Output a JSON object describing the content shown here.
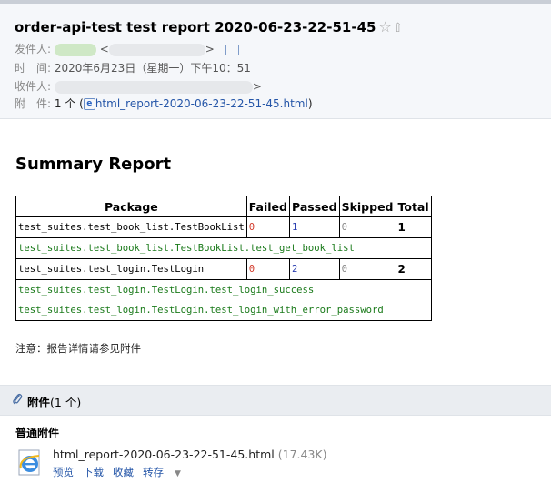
{
  "header": {
    "subject": "order-api-test test report 2020-06-23-22-51-45",
    "star_glyph": "☆",
    "share_glyph": "⇧",
    "from_label": "发件人:",
    "from_open": "<",
    "from_close": ">",
    "time_label": "时　间:",
    "time_value": "2020年6月23日（星期一）下午10：51",
    "to_label": "收件人:",
    "to_close": ">",
    "att_label": "附　件:",
    "att_count": "1 个 (",
    "att_file": "html_report-2020-06-23-22-51-45.html",
    "att_close": ")"
  },
  "report": {
    "title": "Summary Report",
    "columns": [
      "Package",
      "Failed",
      "Passed",
      "Skipped",
      "Total"
    ],
    "groups": [
      {
        "package": "test_suites.test_book_list.TestBookList",
        "failed": "0",
        "passed": "1",
        "skipped": "0",
        "total": "1",
        "cases": [
          "test_suites.test_book_list.TestBookList.test_get_book_list"
        ]
      },
      {
        "package": "test_suites.test_login.TestLogin",
        "failed": "0",
        "passed": "2",
        "skipped": "0",
        "total": "2",
        "cases": [
          "test_suites.test_login.TestLogin.test_login_success",
          "test_suites.test_login.TestLogin.test_login_with_error_password"
        ]
      }
    ],
    "note": "注意：报告详情请参见附件"
  },
  "attachments": {
    "clip_icon": "paperclip-icon",
    "label": "附件",
    "count": "(1 个)",
    "section": "普通附件",
    "file_name": "html_report-2020-06-23-22-51-45.html",
    "file_size": "(17.43K)",
    "actions": [
      "预览",
      "下载",
      "收藏",
      "转存"
    ]
  },
  "colors": {
    "failed": "#d23a2a",
    "passed": "#2a3eb0",
    "skipped": "#888888",
    "case": "#1a7a1a",
    "link": "#2556a8"
  }
}
